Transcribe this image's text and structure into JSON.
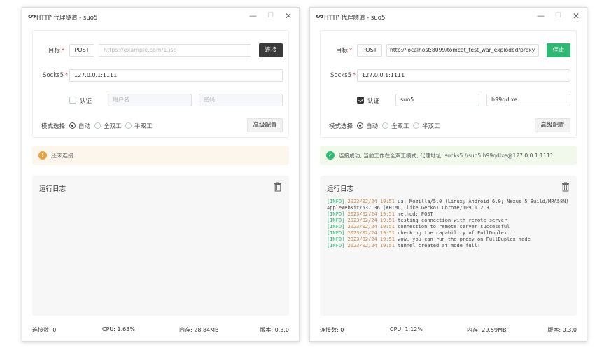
{
  "left_window": {
    "title": "HTTP 代理隧道 - suo5",
    "target_label": "目标",
    "method": "POST",
    "url_placeholder": "https://example.com/1.jsp",
    "connect_button": "连接",
    "socks5_label": "Socks5",
    "socks5_value": "127.0.0.1:1111",
    "auth_label": "认证",
    "auth_checked": false,
    "username_placeholder": "用户名",
    "password_placeholder": "密码",
    "mode_label": "模式选择",
    "mode_options": [
      "自动",
      "全双工",
      "半双工"
    ],
    "mode_selected": "自动",
    "advanced_button": "高级配置",
    "alert_text": "还未连接",
    "log_title": "运行日志",
    "status": {
      "connections": "连接数: 0",
      "cpu": "CPU: 1.63%",
      "memory": "内存: 28.84MB",
      "version": "版本: 0.3.0"
    }
  },
  "right_window": {
    "title": "HTTP 代理隧道 - suo5",
    "target_label": "目标",
    "method": "POST",
    "url_value": "http://localhost:8099/tomcat_test_war_exploded/proxy.",
    "stop_button": "停止",
    "socks5_label": "Socks5",
    "socks5_value": "127.0.0.1:1111",
    "auth_label": "认证",
    "auth_checked": true,
    "username_value": "suo5",
    "password_value": "h99qdlxe",
    "mode_label": "模式选择",
    "mode_options": [
      "自动",
      "全双工",
      "半双工"
    ],
    "mode_selected": "自动",
    "advanced_button": "高级配置",
    "alert_text": "连接成功, 当前工作在全双工模式, 代理地址: socks5://suo5:h99qdlxe@127.0.0.1:1111",
    "log_title": "运行日志",
    "logs": [
      {
        "level": "[INFO]",
        "time": "2023/02/24 19:51",
        "msg": "ua: Mozilla/5.0 (Linux; Android 6.0; Nexus 5 Build/MRA58N) AppleWebKit/537.36 (KHTML, like Gecko) Chrome/109.1.2.3"
      },
      {
        "level": "[INFO]",
        "time": "2023/02/24 19:51",
        "msg": "method: POST"
      },
      {
        "level": "[INFO]",
        "time": "2023/02/24 19:51",
        "msg": "testing connection with remote server"
      },
      {
        "level": "[INFO]",
        "time": "2023/02/24 19:51",
        "msg": "connection to remote server successful"
      },
      {
        "level": "[INFO]",
        "time": "2023/02/24 19:51",
        "msg": "checking the capability of FullDuplex.."
      },
      {
        "level": "[INFO]",
        "time": "2023/02/24 19:51",
        "msg": "wow, you can run the proxy on FullDuplex mode"
      },
      {
        "level": "[INFO]",
        "time": "2023/02/24 19:51",
        "msg": "tunnel created at mode full!"
      }
    ],
    "status": {
      "connections": "连接数: 0",
      "cpu": "CPU: 1.12%",
      "memory": "内存: 29.59MB",
      "version": "版本: 0.3.0"
    }
  },
  "icons": {
    "app": "app-logo-icon",
    "minimize": "minimize-icon",
    "maximize": "maximize-icon",
    "close": "close-icon",
    "warning": "warning-icon",
    "success": "check-circle-icon",
    "trash": "trash-icon"
  },
  "colors": {
    "success": "#2eb873",
    "warning": "#e6a23c",
    "dark_button": "#3a3a3a"
  }
}
